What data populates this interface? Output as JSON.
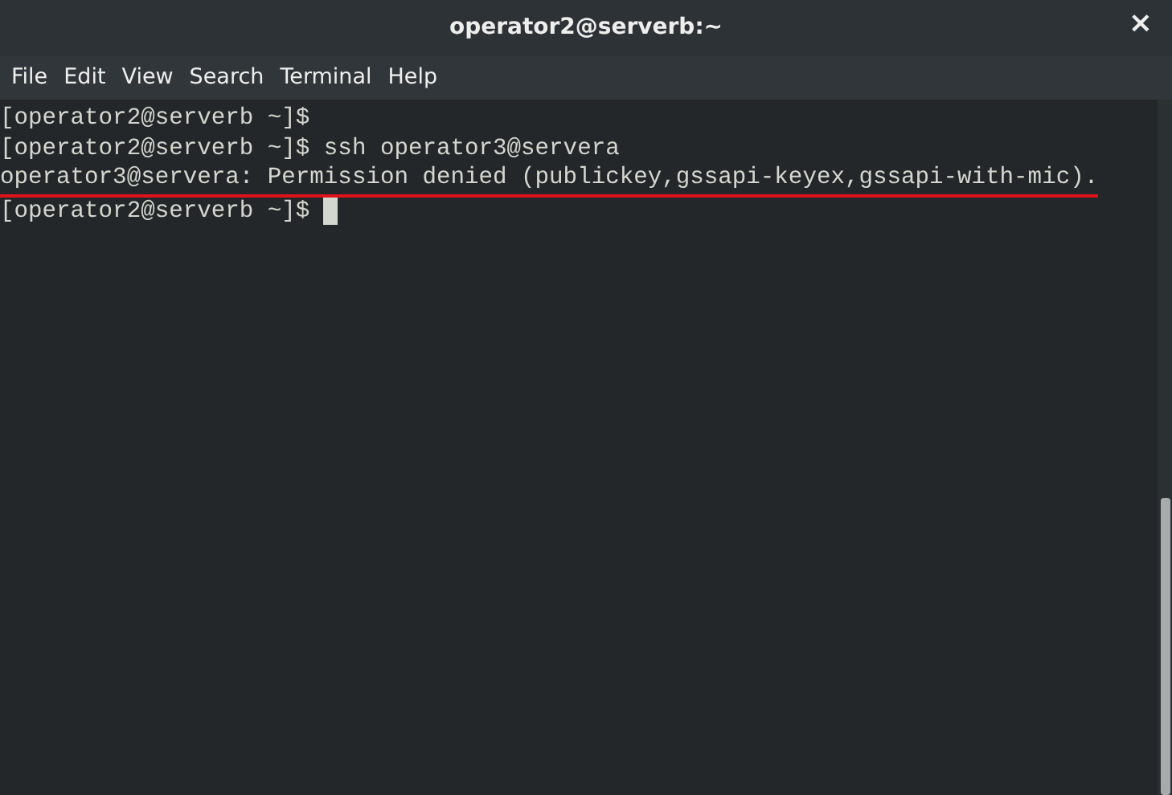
{
  "window": {
    "title": "operator2@serverb:~",
    "close": "×"
  },
  "menu": [
    "File",
    "Edit",
    "View",
    "Search",
    "Terminal",
    "Help"
  ],
  "lines": [
    {
      "text": "[operator2@serverb ~]$",
      "underlined": false,
      "cursor": false
    },
    {
      "text": "[operator2@serverb ~]$ ssh operator3@servera",
      "underlined": false,
      "cursor": false
    },
    {
      "text": "operator3@servera: Permission denied (publickey,gssapi-keyex,gssapi-with-mic).",
      "underlined": true,
      "cursor": false
    },
    {
      "text": "[operator2@serverb ~]$ ",
      "underlined": false,
      "cursor": true
    }
  ]
}
